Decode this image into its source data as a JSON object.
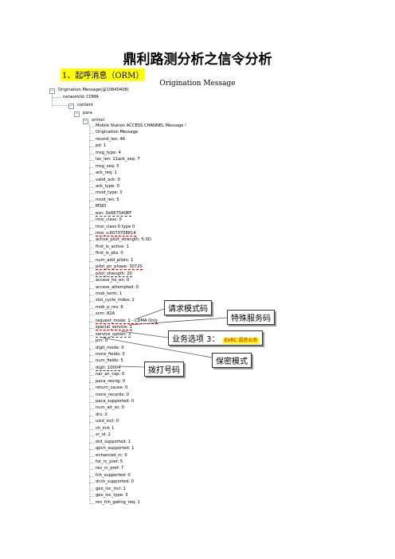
{
  "doc": {
    "title": "鼎利路测分析之信令分析",
    "section": "1、起呼消息（ORM）",
    "subtitle": "Origination Message"
  },
  "tree": {
    "root": "Origination Message(@10840408)",
    "networkid": "networkId: CDMA",
    "content": "content",
    "para": "para",
    "orimsl": "orimsl",
    "fields": [
      "Mobile Station ACCESS CHANNEL Message !",
      "Origination Message",
      "record_len: 46",
      "pd: 1",
      "msg_type: 4",
      "lac_len: 11ack_seq: 7",
      "msg_seq: 5",
      "ack_req: 1",
      "valid_ack: 0",
      "ack_type: 0",
      "msid_type: 3",
      "msid_len: 5",
      "MSID",
      "esn: 0x6675A0EF",
      "imsi_class: 0",
      "imsi_class 0 type 0",
      "imsi_s:6070708814",
      "active_pilot_strength: 5.0D",
      "first_is_active: 1",
      "first_is_pta: 0",
      "num_add_pilots: 1",
      "pilot_pn_phase: 30720",
      "pilot_strength: 20",
      "access_ho_en: 0",
      "access_attempted: 0",
      "mob_term: 1",
      "slot_cycle_index: 2",
      "mob_p_rev: 6",
      "scm: 82A",
      "request_mode: 1 - CDMA Only",
      "special_service: 1",
      "service_option: 3",
      "pm: 0",
      "digit_mode: 0",
      "more_fields: 0",
      "num_fields: 5",
      "digit: 10004",
      "nar_an_cap: 0",
      "paca_reorig: 0",
      "return_cause: 0",
      "more_records: 0",
      "paca_supported: 0",
      "num_alt_so: 0",
      "drs: 0",
      "uzid_incl: 0",
      "ch_ind: 1",
      "sr_id: 2",
      "otd_supported: 1",
      "qpch_supported: 1",
      "enhanced_rc: 0",
      "for_rc_pref: 5",
      "rev_rc_pref: 7",
      "fch_supported: 0",
      "dcch_supported: 0",
      "geo_loc_incl: 1",
      "geo_loc_type: 3",
      "rev_fch_gating_req: 1"
    ]
  },
  "callouts": {
    "request_mode": "请求模式码",
    "special_service": "特殊服务码",
    "service_option": "业务选项 3：",
    "service_option_note": "EVRC 语音业务",
    "privacy": "保密模式",
    "dial": "拨打号码"
  }
}
